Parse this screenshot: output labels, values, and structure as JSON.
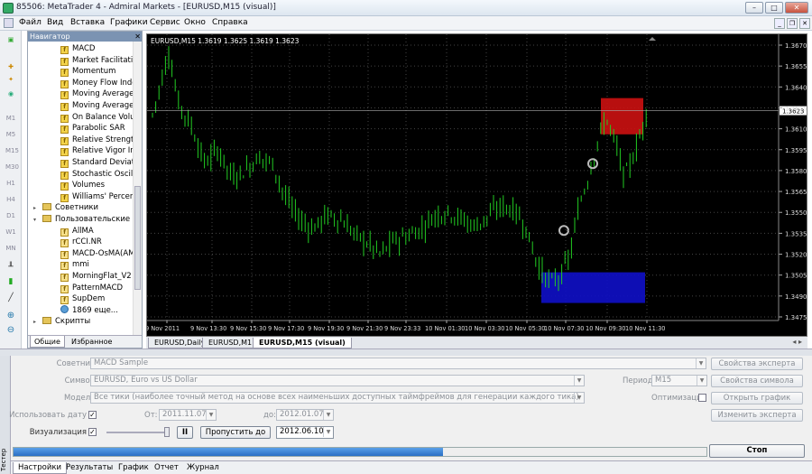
{
  "window": {
    "title": "85506: MetaTrader 4 - Admiral Markets - [EURUSD,M15 (visual)]"
  },
  "menu": [
    "Файл",
    "Вид",
    "Вставка",
    "Графики",
    "Сервис",
    "Окно",
    "Справка"
  ],
  "toolbar_labels": [
    "M1",
    "M5",
    "M15",
    "M30",
    "H1",
    "H4",
    "D1",
    "W1",
    "MN"
  ],
  "navigator": {
    "title": "Навигатор",
    "items": [
      {
        "label": "MACD",
        "type": "f"
      },
      {
        "label": "Market Facilitation Index",
        "type": "f"
      },
      {
        "label": "Momentum",
        "type": "f"
      },
      {
        "label": "Money Flow Index",
        "type": "f"
      },
      {
        "label": "Moving Average",
        "type": "f"
      },
      {
        "label": "Moving Average of Oscillator",
        "type": "f"
      },
      {
        "label": "On Balance Volume",
        "type": "f"
      },
      {
        "label": "Parabolic SAR",
        "type": "f"
      },
      {
        "label": "Relative Strength Index",
        "type": "f"
      },
      {
        "label": "Relative Vigor Index",
        "type": "f"
      },
      {
        "label": "Standard Deviation",
        "type": "f"
      },
      {
        "label": "Stochastic Oscillator",
        "type": "f"
      },
      {
        "label": "Volumes",
        "type": "f"
      },
      {
        "label": "Williams' Percent Range",
        "type": "f"
      },
      {
        "label": "Советники",
        "type": "folder"
      },
      {
        "label": "Пользовательские индикаторы",
        "type": "folder"
      },
      {
        "label": "AllMA",
        "type": "c"
      },
      {
        "label": "rCCI.NR",
        "type": "c"
      },
      {
        "label": "MACD-OsMA(AMA)",
        "type": "c"
      },
      {
        "label": "mmi",
        "type": "c"
      },
      {
        "label": "MorningFlat_V2",
        "type": "c"
      },
      {
        "label": "PatternMACD",
        "type": "c"
      },
      {
        "label": "SupDem",
        "type": "c"
      },
      {
        "label": "1869 еще...",
        "type": "more"
      },
      {
        "label": "Скрипты",
        "type": "folder"
      }
    ],
    "tabs": [
      "Общие",
      "Избранное"
    ]
  },
  "chart": {
    "info": "EURUSD,M15  1.3619 1.3625 1.3619 1.3623",
    "current_price": "1.3623",
    "price_ticks": [
      "1.3670",
      "1.3655",
      "1.3640",
      "1.3625",
      "1.3610",
      "1.3595",
      "1.3580",
      "1.3565",
      "1.3550",
      "1.3535",
      "1.3520",
      "1.3505",
      "1.3490",
      "1.3475"
    ],
    "time_ticks": [
      "9 Nov 2011",
      "9 Nov 13:30",
      "9 Nov 15:30",
      "9 Nov 17:30",
      "9 Nov 19:30",
      "9 Nov 21:30",
      "9 Nov 23:33",
      "10 Nov 01:30",
      "10 Nov 03:30",
      "10 Nov 05:30",
      "10 Nov 07:30",
      "10 Nov 09:30",
      "10 Nov 11:30"
    ],
    "tabs": [
      "EURUSD,Daily",
      "EURUSD,M1",
      "EURUSD,M15 (visual)"
    ],
    "colors": {
      "bull": "#22cc22",
      "supply": "#cc1111",
      "demand": "#1010c8"
    }
  },
  "tester": {
    "expert_label": "Советник:",
    "expert_value": "MACD Sample",
    "symbol_label": "Символ:",
    "symbol_value": "EURUSD, Euro vs US Dollar",
    "model_label": "Модель:",
    "model_value": "Все тики (наиболее точный метод на основе всех наименьших доступных таймфреймов для генерации каждого тика)",
    "use_date_label": "Использовать дату",
    "from_label": "От:",
    "from_value": "2011.11.07",
    "to_label": "до:",
    "to_value": "2012.01.07",
    "visual_label": "Визуализация",
    "skip_button": "Пропустить до",
    "skip_date": "2012.06.10",
    "period_label": "Период:",
    "period_value": "M15",
    "optimization_label": "Оптимизация",
    "btn_expert_props": "Свойства эксперта",
    "btn_symbol_props": "Свойства символа",
    "btn_open_chart": "Открыть график",
    "btn_edit_expert": "Изменить эксперта",
    "btn_stop": "Стоп",
    "progress": 0.62,
    "side_label": "Тестер",
    "tabs": [
      "Настройки",
      "Результаты",
      "График",
      "Отчет",
      "Журнал"
    ]
  }
}
